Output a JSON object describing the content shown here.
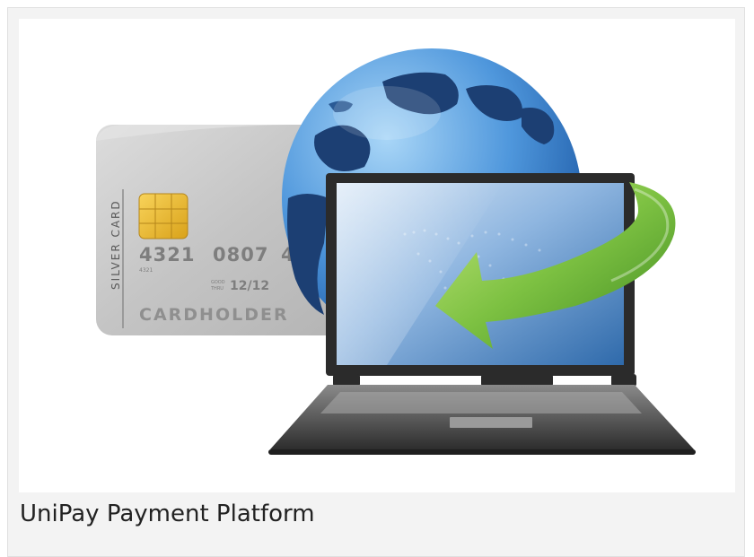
{
  "caption": "UniPay Payment Platform",
  "illustration": {
    "card_label": "SILVER CARD",
    "card_number_1": "4321",
    "card_number_2": "0807",
    "card_number_3": "4",
    "card_small_number": "4321",
    "card_good_thru_1": "GOOD",
    "card_good_thru_2": "THRU",
    "card_expiry": "12/12",
    "card_holder": "CARDHOLDER"
  },
  "colors": {
    "arrow": "#7dc142",
    "globe_ocean": "#4a90d8",
    "globe_land": "#1c3f73",
    "card": "#c9c9c9",
    "laptop": "#3a3a3a"
  }
}
